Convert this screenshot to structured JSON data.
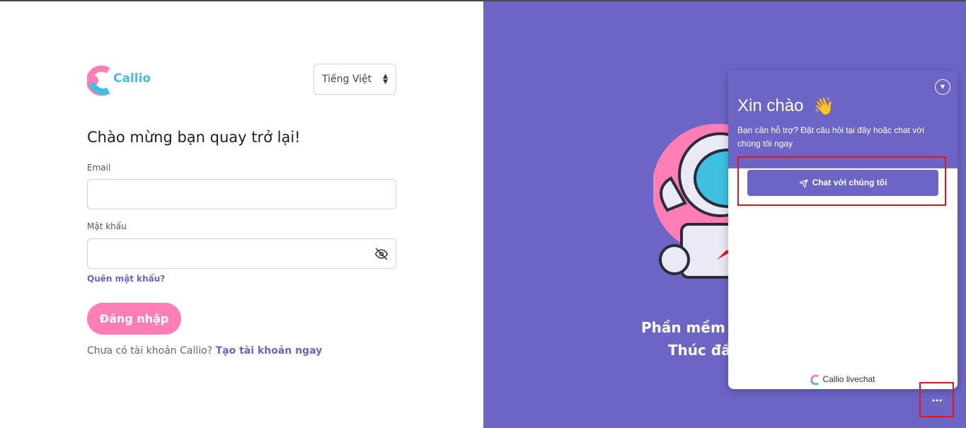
{
  "brand": {
    "name": "Callio",
    "pink": "#ff7eb6",
    "cyan": "#3ec1e0",
    "purple": "#6c65c5"
  },
  "language_select": {
    "value": "Tiếng Việt"
  },
  "login": {
    "heading": "Chào mừng bạn quay trở lại!",
    "email_label": "Email",
    "email_value": "",
    "password_label": "Mật khẩu",
    "password_value": "",
    "forgot_link": "Quên mật khẩu?",
    "submit_label": "Đăng nhập",
    "signup_text": "Chưa có tài khoản Callio?",
    "signup_link": "Tạo tài khoản ngay"
  },
  "promo": {
    "line1": "Phần mềm quản lý ki",
    "line2": "Thúc đẩy tăng"
  },
  "livechat": {
    "title": "Xin chào",
    "wave_icon": "👋",
    "subtitle": "Bạn cần hỗ trợ? Đặt câu hỏi tại đây hoặc chat với chúng tôi ngay",
    "chat_button": "Chat với chúng tôi",
    "footer": "Callio livechat",
    "icons": [
      "collapse-icon",
      "send-icon",
      "chat-bubble-icon"
    ]
  }
}
